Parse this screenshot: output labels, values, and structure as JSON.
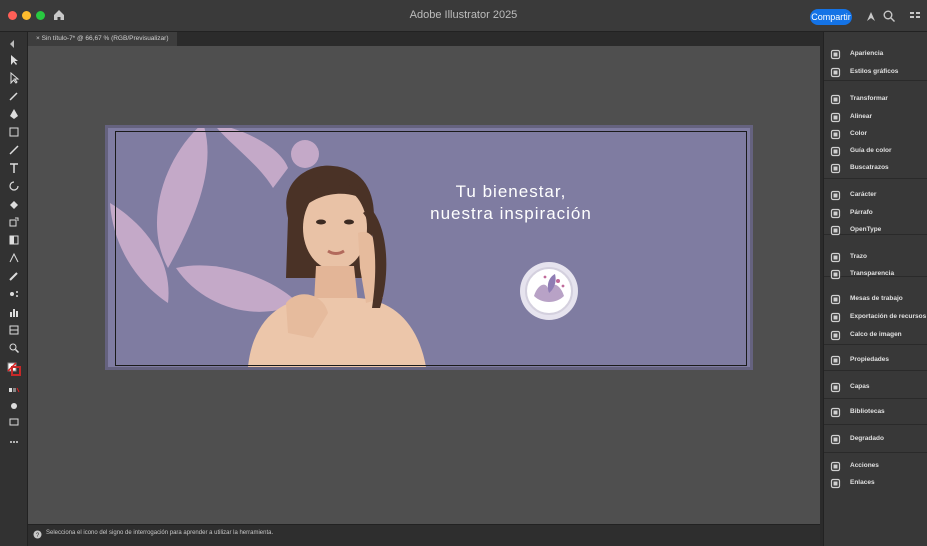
{
  "app": {
    "title": "Adobe Illustrator 2025",
    "share_label": "Compartir"
  },
  "document": {
    "tab_label": "Sin título-7* @ 66,67 % (RGB/Previsualizar)"
  },
  "artboard": {
    "headline_line1": "Tu bienestar,",
    "headline_line2": "nuestra inspiración"
  },
  "status": {
    "message": "Selecciona el icono del signo de interrogación para aprender a utilizar la herramienta."
  },
  "panels": [
    {
      "label": "Apariencia",
      "icon": "appearance-icon"
    },
    {
      "label": "Estilos gráficos",
      "icon": "graphic-styles-icon"
    },
    {
      "label": "Transformar",
      "icon": "transform-icon"
    },
    {
      "label": "Alinear",
      "icon": "align-icon"
    },
    {
      "label": "Color",
      "icon": "color-icon"
    },
    {
      "label": "Guía de color",
      "icon": "color-guide-icon"
    },
    {
      "label": "Buscatrazos",
      "icon": "pathfinder-icon"
    },
    {
      "label": "Carácter",
      "icon": "character-icon"
    },
    {
      "label": "Párrafo",
      "icon": "paragraph-icon"
    },
    {
      "label": "OpenType",
      "icon": "opentype-icon"
    },
    {
      "label": "Trazo",
      "icon": "stroke-icon"
    },
    {
      "label": "Transparencia",
      "icon": "transparency-icon"
    },
    {
      "label": "Mesas de trabajo",
      "icon": "artboards-icon"
    },
    {
      "label": "Exportación de recursos",
      "icon": "asset-export-icon"
    },
    {
      "label": "Calco de imagen",
      "icon": "image-trace-icon"
    },
    {
      "label": "Propiedades",
      "icon": "properties-icon"
    },
    {
      "label": "Capas",
      "icon": "layers-icon"
    },
    {
      "label": "Bibliotecas",
      "icon": "libraries-icon"
    },
    {
      "label": "Degradado",
      "icon": "gradient-icon"
    },
    {
      "label": "Acciones",
      "icon": "actions-icon"
    },
    {
      "label": "Enlaces",
      "icon": "links-icon"
    }
  ],
  "colors": {
    "artboard_bg": "#7f7ca1",
    "leaf": "#c4a9c8",
    "accent": "#1473e6"
  }
}
